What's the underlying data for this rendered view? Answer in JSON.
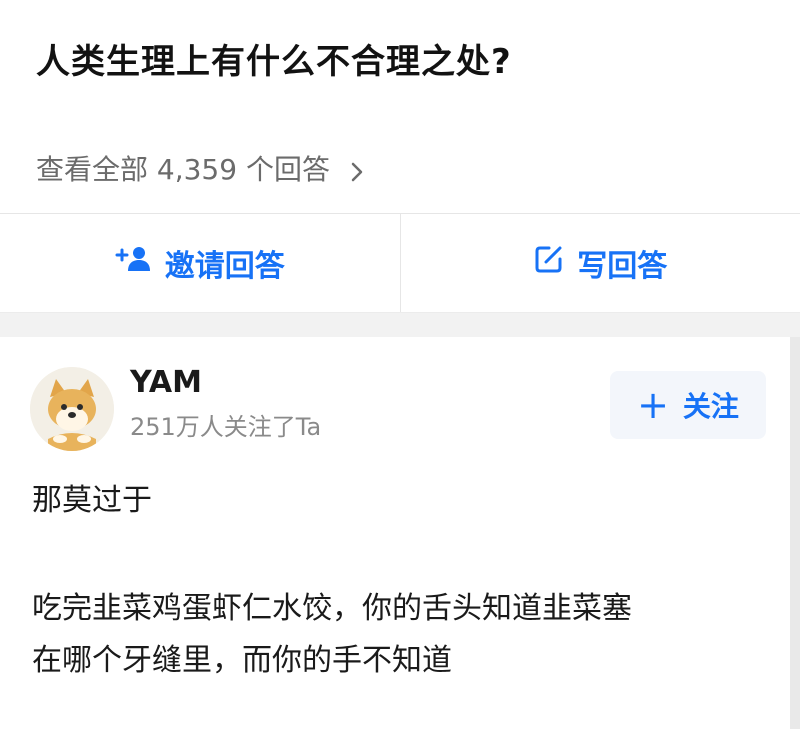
{
  "question": {
    "title": "人类生理上有什么不合理之处?",
    "view_all": "查看全部 4,359 个回答"
  },
  "actions": {
    "invite_label": "邀请回答",
    "write_label": "写回答"
  },
  "answer": {
    "author": "YAM",
    "followers": "251万人关注了Ta",
    "follow_label": "关注",
    "paragraphs": [
      "那莫过于",
      "吃完韭菜鸡蛋虾仁水饺，你的舌头知道韭菜塞",
      "在哪个牙缝里，而你的手不知道"
    ]
  },
  "colors": {
    "accent": "#1772f6",
    "muted_text": "#6b6b6b",
    "divider": "#e6e6e6"
  },
  "icons": {
    "view_all": "chevron-right-icon",
    "invite": "add-person-icon",
    "write": "edit-icon",
    "follow": "plus-icon",
    "avatar": "doge-avatar-icon"
  }
}
